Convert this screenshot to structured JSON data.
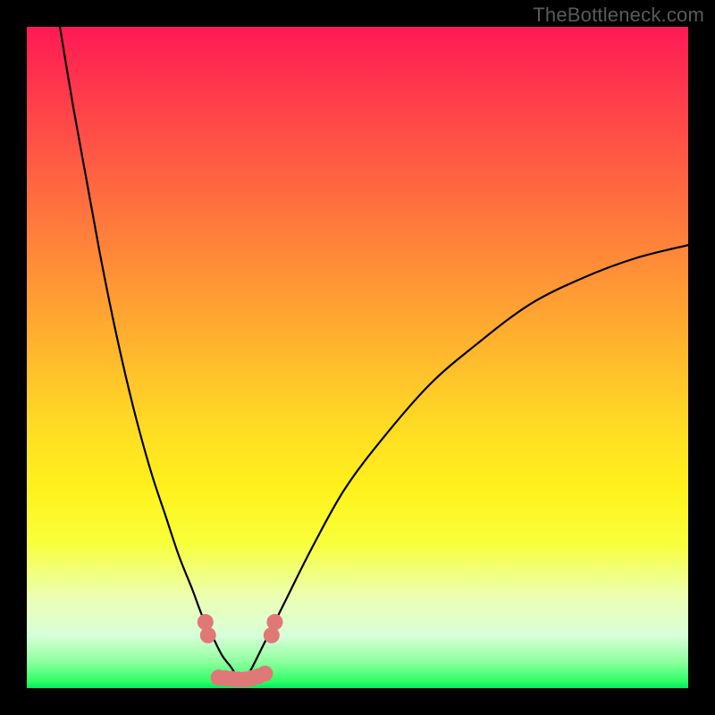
{
  "watermark": "TheBottleneck.com",
  "chart_data": {
    "type": "line",
    "title": "",
    "xlabel": "",
    "ylabel": "",
    "xlim": [
      0,
      100
    ],
    "ylim": [
      0,
      100
    ],
    "grid": false,
    "legend": false,
    "series": [
      {
        "name": "left-curve",
        "color": "#000000",
        "x": [
          5,
          7,
          9,
          11,
          13,
          15,
          17,
          19,
          21,
          23,
          25,
          26.5,
          28,
          29.5,
          31,
          32.5
        ],
        "y": [
          100,
          88,
          77,
          66,
          56,
          47,
          39,
          32,
          26,
          20,
          15,
          11,
          8,
          5,
          3,
          0.5
        ]
      },
      {
        "name": "right-curve",
        "color": "#000000",
        "x": [
          32.5,
          34,
          36,
          39,
          43,
          48,
          54,
          61,
          68,
          76,
          84,
          92,
          100
        ],
        "y": [
          0.5,
          3,
          7,
          13,
          21,
          30,
          38,
          46,
          52,
          58,
          62,
          65,
          67
        ]
      },
      {
        "name": "bottom-nodes",
        "color": "#e07878",
        "type": "scatter",
        "x": [
          27.0,
          27.4,
          29.0,
          30.0,
          31.0,
          32.0,
          33.0,
          34.0,
          35.0,
          36.0,
          37.0,
          37.5
        ],
        "y": [
          10.0,
          8.0,
          1.6,
          1.5,
          1.4,
          1.3,
          1.3,
          1.5,
          1.8,
          2.2,
          8.0,
          10.0
        ]
      }
    ]
  }
}
